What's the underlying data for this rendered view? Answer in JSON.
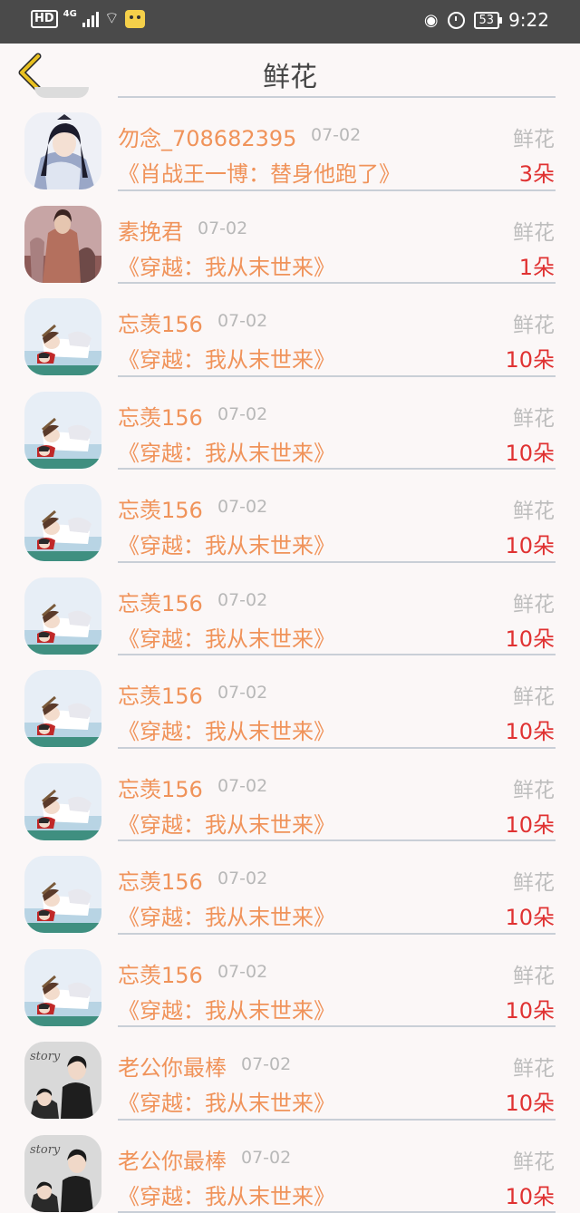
{
  "status_bar": {
    "hd": "HD",
    "network": "4G",
    "battery": "53",
    "time": "9:22",
    "icons": [
      "signal-icon",
      "wifi-icon",
      "wechat-icon",
      "eye-icon",
      "alarm-icon",
      "battery-icon"
    ]
  },
  "header": {
    "title": "鲜花",
    "back_icon": "chevron-left-icon"
  },
  "records": [
    {
      "name": "勿念_708682395",
      "date": "07-02",
      "gift": "鲜花",
      "book": "《肖战王一博：替身他跑了》",
      "count": "3朵",
      "avatar": "ancient-man"
    },
    {
      "name": "素挽君",
      "date": "07-02",
      "gift": "鲜花",
      "book": "《穿越：我从末世来》",
      "count": "1朵",
      "avatar": "ancient-woman"
    },
    {
      "name": "忘羡156",
      "date": "07-02",
      "gift": "鲜花",
      "book": "《穿越：我从末世来》",
      "count": "10朵",
      "avatar": "anime-couple"
    },
    {
      "name": "忘羡156",
      "date": "07-02",
      "gift": "鲜花",
      "book": "《穿越：我从末世来》",
      "count": "10朵",
      "avatar": "anime-couple"
    },
    {
      "name": "忘羡156",
      "date": "07-02",
      "gift": "鲜花",
      "book": "《穿越：我从末世来》",
      "count": "10朵",
      "avatar": "anime-couple"
    },
    {
      "name": "忘羡156",
      "date": "07-02",
      "gift": "鲜花",
      "book": "《穿越：我从末世来》",
      "count": "10朵",
      "avatar": "anime-couple"
    },
    {
      "name": "忘羡156",
      "date": "07-02",
      "gift": "鲜花",
      "book": "《穿越：我从末世来》",
      "count": "10朵",
      "avatar": "anime-couple"
    },
    {
      "name": "忘羡156",
      "date": "07-02",
      "gift": "鲜花",
      "book": "《穿越：我从末世来》",
      "count": "10朵",
      "avatar": "anime-couple"
    },
    {
      "name": "忘羡156",
      "date": "07-02",
      "gift": "鲜花",
      "book": "《穿越：我从末世来》",
      "count": "10朵",
      "avatar": "anime-couple"
    },
    {
      "name": "忘羡156",
      "date": "07-02",
      "gift": "鲜花",
      "book": "《穿越：我从末世来》",
      "count": "10朵",
      "avatar": "anime-couple"
    },
    {
      "name": "老公你最棒",
      "date": "07-02",
      "gift": "鲜花",
      "book": "《穿越：我从末世来》",
      "count": "10朵",
      "avatar": "photo-couple"
    },
    {
      "name": "老公你最棒",
      "date": "07-02",
      "gift": "鲜花",
      "book": "《穿越：我从末世来》",
      "count": "10朵",
      "avatar": "photo-couple"
    }
  ],
  "colors": {
    "name": "#f0935a",
    "book": "#f0935a",
    "count": "#e03232",
    "muted": "#bdbdbd",
    "back_arrow": "#e8c020"
  }
}
